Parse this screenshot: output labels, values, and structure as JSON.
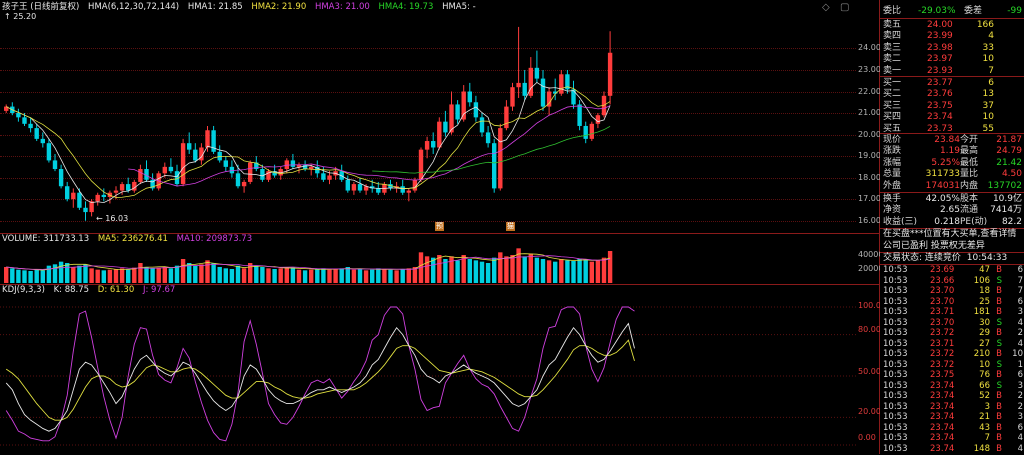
{
  "main": {
    "title": "孩子王 (日线前复权)",
    "hma_params": "HMA(6,12,30,72,144)",
    "hma1": "HMA1: 21.85",
    "hma2": "HMA2: 21.90",
    "hma3": "HMA3: 21.00",
    "hma4": "HMA4: 19.73",
    "hma5": "HMA5: -",
    "high_note": "25.20",
    "low_note": "16.03",
    "y_ticks": [
      "24.00",
      "23.00",
      "22.00",
      "21.00",
      "20.00",
      "19.00",
      "18.00",
      "17.00",
      "16.00"
    ],
    "markers": [
      "预",
      "猫"
    ]
  },
  "volume": {
    "label": "VOLUME: 311733.13",
    "ma5": "MA5: 236276.41",
    "ma10": "MA10: 209873.73",
    "ticks": [
      "40000",
      "20000"
    ]
  },
  "kdj": {
    "label": "KDJ(9,3,3)",
    "k": "K: 88.75",
    "d": "D: 61.30",
    "j": "J: 97.67",
    "ticks": [
      "100.00",
      "80.00",
      "50.00",
      "20.00",
      "0.00"
    ]
  },
  "colors": {
    "up": "#ff3c3c",
    "down": "#00d0e0",
    "k_line": "#e8e8e8",
    "d_line": "#e0e040",
    "j_line": "#d040e0",
    "ma_green": "#30c030"
  },
  "sidebar": {
    "weibi_label": "委比",
    "weibi_value": "-29.03%",
    "weicha_label": "委差",
    "weicha_value": "-99",
    "sells": [
      {
        "label": "卖五",
        "price": "24.00",
        "vol": "166"
      },
      {
        "label": "卖四",
        "price": "23.99",
        "vol": "4"
      },
      {
        "label": "卖三",
        "price": "23.98",
        "vol": "33"
      },
      {
        "label": "卖二",
        "price": "23.97",
        "vol": "10"
      },
      {
        "label": "卖一",
        "price": "23.93",
        "vol": "7"
      }
    ],
    "buys": [
      {
        "label": "买一",
        "price": "23.77",
        "vol": "6"
      },
      {
        "label": "买二",
        "price": "23.76",
        "vol": "13"
      },
      {
        "label": "买三",
        "price": "23.75",
        "vol": "37"
      },
      {
        "label": "买四",
        "price": "23.74",
        "vol": "10"
      },
      {
        "label": "买五",
        "price": "23.73",
        "vol": "55"
      }
    ],
    "quote": [
      {
        "l": "现价",
        "v": "23.84",
        "l2": "今开",
        "v2": "21.87",
        "c1": "red",
        "c2": "red"
      },
      {
        "l": "涨跌",
        "v": "1.19",
        "l2": "最高",
        "v2": "24.79",
        "c1": "red",
        "c2": "red"
      },
      {
        "l": "涨幅",
        "v": "5.25%",
        "l2": "最低",
        "v2": "21.42",
        "c1": "red",
        "c2": "green"
      },
      {
        "l": "总量",
        "v": "311733",
        "l2": "量比",
        "v2": "4.50",
        "c1": "yellow",
        "c2": "red"
      },
      {
        "l": "外盘",
        "v": "174031",
        "l2": "内盘",
        "v2": "137702",
        "c1": "red",
        "c2": "green"
      }
    ],
    "stats": [
      {
        "l": "换手",
        "v": "42.05%",
        "l2": "股本",
        "v2": "10.9亿"
      },
      {
        "l": "净资",
        "v": "2.65",
        "l2": "流通",
        "v2": "7414万"
      },
      {
        "l": "收益(三)",
        "v": "0.218",
        "l2": "PE(动)",
        "v2": "82.2"
      }
    ],
    "info1": "在买盘***位置有大买单,查看详情",
    "info2": "公司已盈利 投票权无差异",
    "trade_state_label": "交易状态: 连续竞价",
    "trade_time": "10:54:33",
    "trades": [
      {
        "t": "10:53",
        "p": "23.69",
        "v": "47",
        "bs": "B",
        "n": "6"
      },
      {
        "t": "10:53",
        "p": "23.66",
        "v": "106",
        "bs": "S",
        "n": "7"
      },
      {
        "t": "10:53",
        "p": "23.70",
        "v": "18",
        "bs": "B",
        "n": "7"
      },
      {
        "t": "10:53",
        "p": "23.70",
        "v": "25",
        "bs": "B",
        "n": "6"
      },
      {
        "t": "10:53",
        "p": "23.71",
        "v": "181",
        "bs": "B",
        "n": "3"
      },
      {
        "t": "10:53",
        "p": "23.70",
        "v": "30",
        "bs": "S",
        "n": "4"
      },
      {
        "t": "10:53",
        "p": "23.72",
        "v": "29",
        "bs": "B",
        "n": "2"
      },
      {
        "t": "10:53",
        "p": "23.71",
        "v": "27",
        "bs": "S",
        "n": "4"
      },
      {
        "t": "10:53",
        "p": "23.72",
        "v": "210",
        "bs": "B",
        "n": "10"
      },
      {
        "t": "10:53",
        "p": "23.72",
        "v": "10",
        "bs": "S",
        "n": "1"
      },
      {
        "t": "10:53",
        "p": "23.75",
        "v": "76",
        "bs": "B",
        "n": "6"
      },
      {
        "t": "10:53",
        "p": "23.74",
        "v": "66",
        "bs": "S",
        "n": "3"
      },
      {
        "t": "10:53",
        "p": "23.74",
        "v": "52",
        "bs": "B",
        "n": "2"
      },
      {
        "t": "10:53",
        "p": "23.74",
        "v": "3",
        "bs": "B",
        "n": "2"
      },
      {
        "t": "10:53",
        "p": "23.74",
        "v": "21",
        "bs": "B",
        "n": "3"
      },
      {
        "t": "10:53",
        "p": "23.74",
        "v": "43",
        "bs": "B",
        "n": "6"
      },
      {
        "t": "10:53",
        "p": "23.74",
        "v": "7",
        "bs": "B",
        "n": "4"
      },
      {
        "t": "10:53",
        "p": "23.74",
        "v": "148",
        "bs": "B",
        "n": "4"
      }
    ]
  },
  "chart_data": {
    "type": "candlestick",
    "ylim": [
      15.8,
      25.6
    ],
    "candles": [
      [
        21.1,
        21.4,
        21.0,
        21.3
      ],
      [
        21.3,
        21.5,
        20.9,
        21.0
      ],
      [
        21.0,
        21.2,
        20.6,
        20.8
      ],
      [
        20.8,
        21.0,
        20.4,
        20.5
      ],
      [
        20.5,
        20.8,
        20.1,
        20.3
      ],
      [
        20.3,
        20.5,
        19.7,
        19.8
      ],
      [
        19.8,
        20.1,
        19.4,
        19.6
      ],
      [
        19.6,
        19.8,
        18.7,
        18.8
      ],
      [
        18.8,
        19.1,
        18.3,
        18.4
      ],
      [
        18.4,
        18.6,
        17.5,
        17.6
      ],
      [
        17.6,
        17.8,
        16.9,
        17.0
      ],
      [
        17.0,
        17.5,
        16.6,
        17.3
      ],
      [
        17.3,
        17.5,
        16.5,
        16.6
      ],
      [
        16.6,
        16.9,
        16.0,
        16.4
      ],
      [
        16.4,
        17.0,
        16.2,
        16.9
      ],
      [
        16.9,
        17.3,
        16.7,
        17.2
      ],
      [
        17.2,
        17.5,
        16.9,
        17.1
      ],
      [
        17.1,
        17.4,
        16.8,
        17.3
      ],
      [
        17.3,
        17.6,
        17.0,
        17.4
      ],
      [
        17.4,
        17.8,
        17.2,
        17.7
      ],
      [
        17.7,
        18.0,
        17.3,
        17.4
      ],
      [
        17.4,
        17.9,
        17.3,
        17.8
      ],
      [
        17.8,
        18.6,
        17.7,
        18.4
      ],
      [
        18.4,
        18.8,
        17.8,
        17.9
      ],
      [
        17.9,
        18.2,
        17.4,
        17.5
      ],
      [
        17.5,
        18.3,
        17.4,
        18.2
      ],
      [
        18.2,
        18.7,
        18.0,
        18.5
      ],
      [
        18.5,
        18.9,
        18.2,
        18.3
      ],
      [
        18.3,
        18.6,
        17.6,
        17.7
      ],
      [
        17.7,
        19.8,
        17.6,
        19.6
      ],
      [
        19.6,
        20.1,
        19.1,
        19.3
      ],
      [
        19.3,
        19.6,
        18.7,
        18.8
      ],
      [
        18.8,
        19.6,
        18.6,
        19.4
      ],
      [
        19.4,
        20.4,
        19.2,
        20.2
      ],
      [
        20.2,
        20.4,
        19.1,
        19.2
      ],
      [
        19.2,
        19.5,
        18.7,
        18.8
      ],
      [
        18.8,
        19.0,
        18.3,
        18.5
      ],
      [
        18.5,
        18.8,
        18.0,
        18.2
      ],
      [
        18.2,
        18.6,
        17.5,
        17.6
      ],
      [
        17.6,
        17.9,
        17.3,
        17.8
      ],
      [
        17.8,
        18.8,
        17.7,
        18.7
      ],
      [
        18.7,
        19.0,
        18.3,
        18.4
      ],
      [
        18.4,
        18.6,
        17.8,
        17.9
      ],
      [
        17.9,
        18.4,
        17.8,
        18.3
      ],
      [
        18.3,
        18.6,
        18.0,
        18.1
      ],
      [
        18.1,
        18.5,
        17.9,
        18.4
      ],
      [
        18.4,
        18.9,
        18.2,
        18.8
      ],
      [
        18.8,
        19.1,
        18.4,
        18.5
      ],
      [
        18.5,
        18.7,
        18.2,
        18.6
      ],
      [
        18.6,
        18.8,
        18.3,
        18.4
      ],
      [
        18.4,
        18.6,
        18.1,
        18.5
      ],
      [
        18.5,
        18.8,
        18.0,
        18.2
      ],
      [
        18.2,
        18.5,
        17.8,
        17.9
      ],
      [
        17.9,
        18.3,
        17.7,
        18.1
      ],
      [
        18.1,
        18.5,
        17.9,
        18.3
      ],
      [
        18.3,
        18.6,
        17.8,
        17.9
      ],
      [
        17.9,
        18.1,
        17.3,
        17.4
      ],
      [
        17.4,
        17.8,
        17.2,
        17.7
      ],
      [
        17.7,
        18.0,
        17.3,
        17.4
      ],
      [
        17.4,
        17.7,
        17.2,
        17.6
      ],
      [
        17.6,
        17.9,
        17.3,
        17.5
      ],
      [
        17.5,
        17.8,
        17.2,
        17.3
      ],
      [
        17.3,
        17.8,
        17.2,
        17.7
      ],
      [
        17.7,
        17.9,
        17.4,
        17.5
      ],
      [
        17.5,
        17.8,
        17.3,
        17.6
      ],
      [
        17.6,
        17.9,
        17.2,
        17.3
      ],
      [
        17.3,
        17.5,
        16.9,
        17.4
      ],
      [
        17.4,
        18.0,
        17.3,
        17.9
      ],
      [
        17.9,
        19.4,
        17.8,
        19.3
      ],
      [
        19.3,
        19.9,
        18.9,
        19.7
      ],
      [
        19.7,
        20.1,
        19.1,
        19.4
      ],
      [
        19.4,
        20.8,
        19.3,
        20.6
      ],
      [
        20.6,
        21.1,
        19.9,
        20.1
      ],
      [
        20.1,
        22.0,
        20.0,
        21.4
      ],
      [
        21.4,
        21.6,
        20.5,
        20.7
      ],
      [
        20.7,
        22.3,
        20.6,
        22.0
      ],
      [
        22.0,
        22.4,
        21.3,
        21.5
      ],
      [
        21.5,
        21.8,
        20.6,
        20.8
      ],
      [
        20.8,
        21.0,
        19.9,
        20.1
      ],
      [
        20.1,
        20.4,
        19.4,
        19.6
      ],
      [
        19.6,
        19.8,
        17.3,
        17.5
      ],
      [
        17.5,
        20.5,
        17.4,
        20.3
      ],
      [
        20.3,
        21.6,
        20.2,
        21.3
      ],
      [
        21.3,
        22.4,
        21.1,
        22.2
      ],
      [
        22.2,
        25.0,
        21.7,
        22.4
      ],
      [
        22.4,
        23.0,
        21.6,
        21.8
      ],
      [
        21.8,
        23.6,
        21.7,
        23.1
      ],
      [
        23.1,
        23.9,
        22.4,
        22.6
      ],
      [
        22.6,
        23.0,
        21.1,
        21.3
      ],
      [
        21.3,
        22.2,
        20.9,
        22.0
      ],
      [
        22.0,
        22.6,
        21.6,
        21.9
      ],
      [
        21.9,
        23.0,
        21.8,
        22.8
      ],
      [
        22.8,
        23.0,
        21.9,
        22.1
      ],
      [
        22.1,
        22.5,
        21.2,
        21.4
      ],
      [
        21.4,
        21.6,
        20.2,
        20.4
      ],
      [
        20.4,
        20.6,
        19.6,
        19.8
      ],
      [
        19.8,
        20.6,
        19.7,
        20.5
      ],
      [
        20.5,
        21.0,
        20.3,
        20.9
      ],
      [
        20.9,
        22.0,
        20.8,
        21.8
      ],
      [
        21.8,
        24.8,
        21.4,
        23.8
      ]
    ],
    "volumes": [
      120,
      110,
      100,
      95,
      90,
      105,
      95,
      130,
      140,
      160,
      150,
      120,
      130,
      140,
      110,
      100,
      95,
      100,
      105,
      110,
      100,
      115,
      150,
      120,
      110,
      115,
      120,
      110,
      130,
      180,
      150,
      130,
      140,
      170,
      150,
      120,
      110,
      105,
      130,
      110,
      150,
      130,
      120,
      110,
      105,
      110,
      120,
      115,
      100,
      95,
      100,
      105,
      110,
      100,
      105,
      110,
      120,
      100,
      105,
      95,
      100,
      110,
      105,
      100,
      95,
      105,
      110,
      120,
      230,
      200,
      190,
      210,
      180,
      200,
      170,
      210,
      180,
      170,
      160,
      150,
      190,
      230,
      200,
      210,
      260,
      200,
      220,
      190,
      180,
      170,
      160,
      180,
      170,
      165,
      180,
      175,
      160,
      170,
      190,
      240
    ],
    "vol_max": 270,
    "kdj_k": [
      45,
      40,
      30,
      22,
      18,
      15,
      12,
      10,
      12,
      18,
      25,
      40,
      55,
      60,
      58,
      52,
      45,
      38,
      30,
      35,
      45,
      55,
      62,
      65,
      60,
      55,
      52,
      50,
      54,
      60,
      58,
      52,
      45,
      38,
      32,
      28,
      25,
      28,
      35,
      50,
      58,
      55,
      48,
      40,
      35,
      32,
      30,
      30,
      32,
      35,
      38,
      40,
      40,
      42,
      40,
      38,
      40,
      42,
      45,
      50,
      58,
      62,
      70,
      78,
      85,
      80,
      72,
      65,
      55,
      50,
      48,
      45,
      50,
      52,
      55,
      58,
      55,
      52,
      50,
      48,
      45,
      40,
      35,
      30,
      28,
      30,
      35,
      40,
      50,
      58,
      62,
      70,
      78,
      85,
      80,
      72,
      65,
      60,
      62,
      68,
      75,
      82,
      88,
      70
    ],
    "kdj_d": [
      55,
      52,
      48,
      42,
      36,
      30,
      25,
      20,
      18,
      18,
      20,
      26,
      34,
      42,
      48,
      50,
      50,
      48,
      44,
      42,
      43,
      46,
      51,
      56,
      58,
      57,
      55,
      53,
      53,
      55,
      56,
      55,
      52,
      48,
      44,
      40,
      36,
      34,
      34,
      38,
      42,
      46,
      46,
      45,
      42,
      40,
      37,
      35,
      34,
      34,
      35,
      37,
      38,
      39,
      40,
      40,
      40,
      40,
      42,
      45,
      49,
      53,
      58,
      64,
      70,
      72,
      72,
      70,
      66,
      62,
      58,
      54,
      53,
      52,
      53,
      54,
      55,
      54,
      53,
      51,
      49,
      46,
      43,
      40,
      37,
      35,
      35,
      36,
      40,
      45,
      50,
      56,
      62,
      69,
      72,
      72,
      70,
      67,
      65,
      65,
      67,
      71,
      76,
      61
    ],
    "kdj_j": [
      25,
      18,
      10,
      8,
      5,
      4,
      3,
      3,
      6,
      18,
      36,
      68,
      95,
      97,
      78,
      56,
      35,
      18,
      5,
      20,
      50,
      73,
      85,
      84,
      65,
      51,
      47,
      45,
      56,
      70,
      63,
      46,
      31,
      18,
      9,
      4,
      3,
      15,
      38,
      75,
      90,
      73,
      52,
      30,
      22,
      16,
      15,
      20,
      28,
      37,
      45,
      47,
      45,
      48,
      41,
      34,
      39,
      46,
      52,
      61,
      76,
      80,
      94,
      100,
      100,
      95,
      72,
      55,
      33,
      25,
      27,
      28,
      45,
      52,
      59,
      65,
      55,
      48,
      44,
      42,
      37,
      28,
      20,
      12,
      10,
      20,
      35,
      48,
      70,
      85,
      86,
      98,
      100,
      100,
      95,
      72,
      55,
      46,
      56,
      74,
      91,
      100,
      100,
      97
    ]
  }
}
